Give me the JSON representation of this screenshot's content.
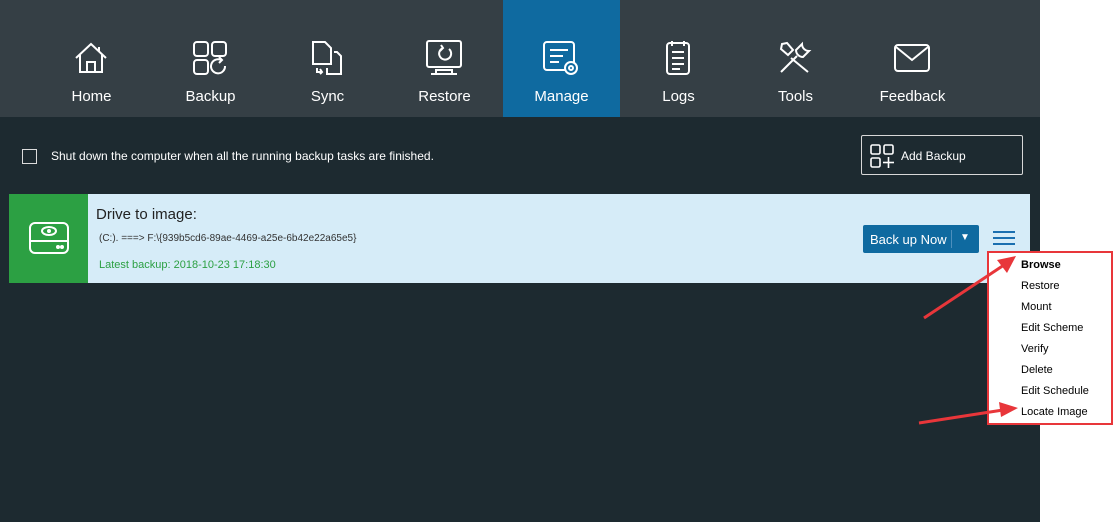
{
  "nav": {
    "items": [
      {
        "label": "Home",
        "icon": "home-icon"
      },
      {
        "label": "Backup",
        "icon": "backup-icon"
      },
      {
        "label": "Sync",
        "icon": "sync-icon"
      },
      {
        "label": "Restore",
        "icon": "restore-icon"
      },
      {
        "label": "Manage",
        "icon": "manage-icon"
      },
      {
        "label": "Logs",
        "icon": "logs-icon"
      },
      {
        "label": "Tools",
        "icon": "tools-icon"
      },
      {
        "label": "Feedback",
        "icon": "feedback-icon"
      }
    ],
    "active": "Manage"
  },
  "options": {
    "shutdown_label": "Shut down the computer when all the running backup tasks are finished.",
    "shutdown_checked": false
  },
  "actions": {
    "add_backup_label": "Add Backup"
  },
  "task": {
    "title": "Drive to image:",
    "path": "(C:). ===> F:\\{939b5cd6-89ae-4469-a25e-6b42e22a65e5}",
    "latest_backup": "Latest backup: 2018-10-23 17:18:30",
    "backup_now_label": "Back up Now",
    "icon": "drive-icon"
  },
  "context_menu": {
    "items": [
      "Browse",
      "Restore",
      "Mount",
      "Edit Scheme",
      "Verify",
      "Delete",
      "Edit Schedule",
      "Locate Image"
    ]
  },
  "colors": {
    "toolbar_bg": "#353f45",
    "active_tab": "#0f6aa0",
    "content_bg": "#1d2a30",
    "card_bg": "#d6ecf8",
    "task_icon_bg": "#2ca043",
    "annotation": "#e8363a"
  }
}
